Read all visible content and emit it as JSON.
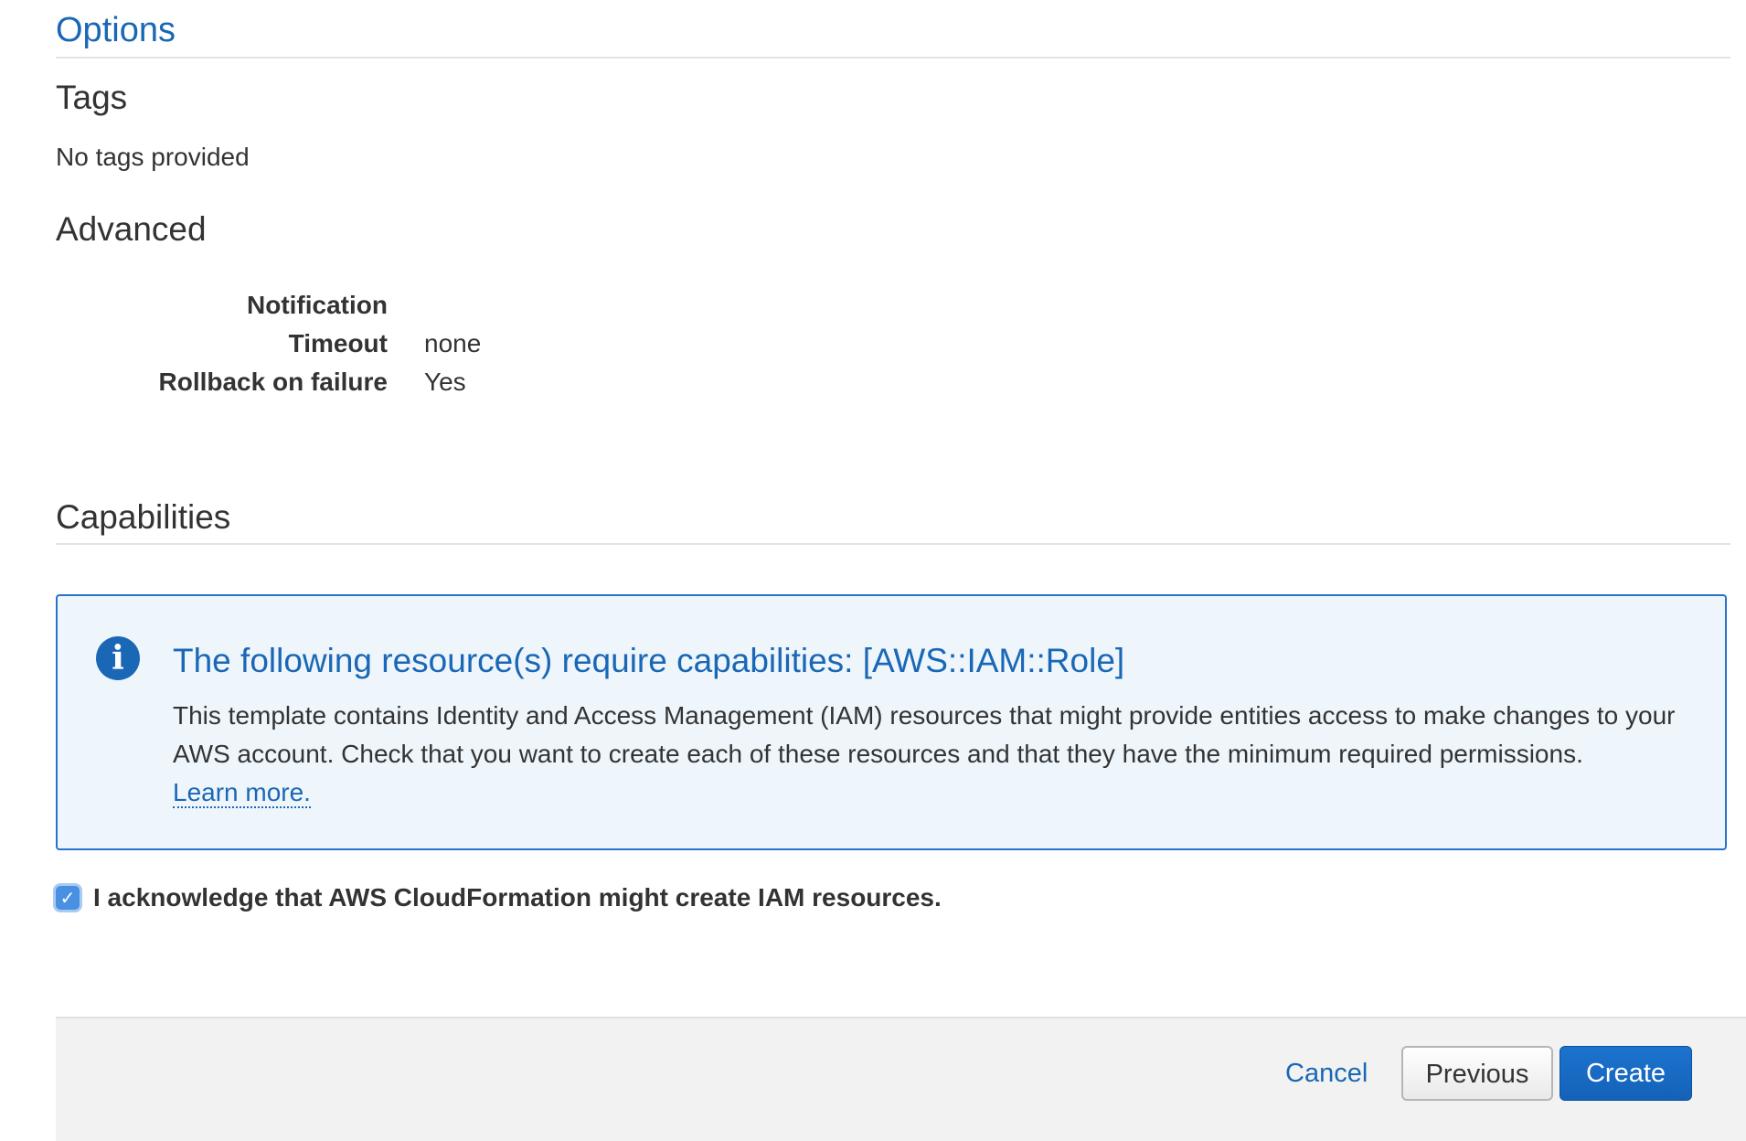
{
  "options": {
    "title": "Options"
  },
  "tags": {
    "heading": "Tags",
    "text": "No tags provided"
  },
  "advanced": {
    "heading": "Advanced",
    "rows": [
      {
        "key": "Notification",
        "value": ""
      },
      {
        "key": "Timeout",
        "value": "none"
      },
      {
        "key": "Rollback on failure",
        "value": "Yes"
      }
    ]
  },
  "capabilities": {
    "heading": "Capabilities",
    "info": {
      "icon": "info-icon",
      "icon_glyph": "i",
      "title": "The following resource(s) require capabilities: [AWS::IAM::Role]",
      "body": "This template contains Identity and Access Management (IAM) resources that might provide entities access to make changes to your AWS account. Check that you want to create each of these resources and that they have the minimum required permissions.",
      "link": "Learn more."
    },
    "acknowledge": {
      "checked": true,
      "check_glyph": "✓",
      "label": "I acknowledge that AWS CloudFormation might create IAM resources."
    }
  },
  "footer": {
    "cancel_label": "Cancel",
    "previous_label": "Previous",
    "create_label": "Create"
  },
  "colors": {
    "link_blue": "#1a67b5",
    "info_bg": "#eef6fc",
    "info_border": "#2a72c9",
    "primary_button": "#1462b8",
    "footer_bg": "#f2f2f2"
  }
}
